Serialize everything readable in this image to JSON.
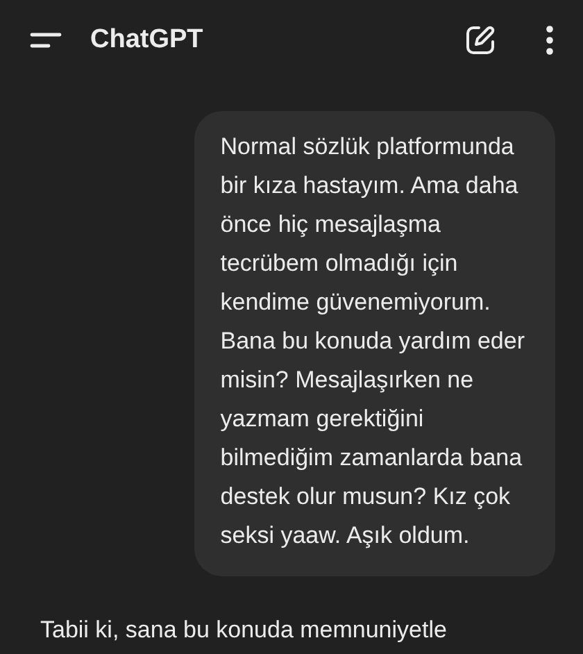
{
  "header": {
    "title": "ChatGPT"
  },
  "messages": [
    {
      "kind": "user",
      "text": "Normal sözlük platformunda\nbir kıza hastayım. Ama daha\nönce hiç mesajlaşma\ntecrübem olmadığı için\nkendime güvenemiyorum.\nBana bu konuda yardım eder\nmisin? Mesajlaşırken ne\nyazmam gerektiğini\nbilmediğim zamanlarda bana\ndestek olur musun? Kız çok\nseksi yaaw. Aşık oldum."
    },
    {
      "kind": "assistant",
      "text": "Tabii ki, sana bu konuda memnuniyetle"
    }
  ]
}
